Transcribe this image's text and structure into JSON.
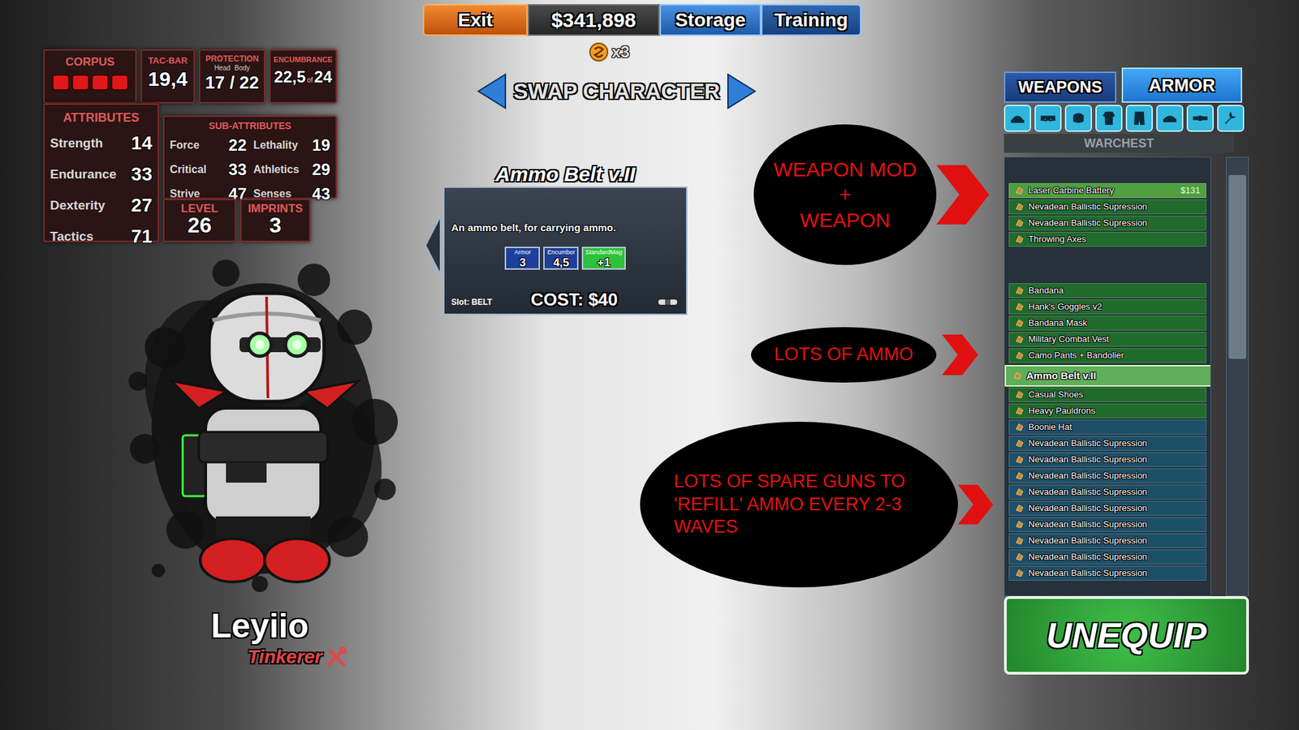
{
  "top_bar": {
    "exit": "Exit",
    "money": "$341,898",
    "storage": "Storage",
    "training": "Training"
  },
  "tokens": {
    "count": "x3"
  },
  "swap_character": {
    "label": "SWAP CHARACTER"
  },
  "stats": {
    "corpus": {
      "label": "CORPUS",
      "pips": [
        {
          "filled": true
        },
        {
          "filled": true
        },
        {
          "filled": true
        },
        {
          "filled": true
        }
      ]
    },
    "tac_bar": {
      "label": "TAC-BAR",
      "value": "19,4"
    },
    "protection": {
      "label": "PROTECTION",
      "head_label": "Head",
      "body_label": "Body",
      "value": "17 / 22"
    },
    "encumbrance": {
      "label": "ENCUMBRANCE",
      "value": "22,5",
      "of": "of",
      "max": "24"
    },
    "attributes": {
      "label": "ATTRIBUTES",
      "items": [
        {
          "name": "Strength",
          "value": "14"
        },
        {
          "name": "Endurance",
          "value": "33"
        },
        {
          "name": "Dexterity",
          "value": "27"
        },
        {
          "name": "Tactics",
          "value": "71"
        }
      ]
    },
    "sub_attributes": {
      "label": "SUB-ATTRIBUTES",
      "items": [
        {
          "name": "Force",
          "value": "22"
        },
        {
          "name": "Lethality",
          "value": "19"
        },
        {
          "name": "Critical",
          "value": "33"
        },
        {
          "name": "Athletics",
          "value": "29"
        },
        {
          "name": "Strive",
          "value": "47"
        },
        {
          "name": "Senses",
          "value": "43"
        }
      ]
    },
    "level": {
      "label": "LEVEL",
      "value": "26"
    },
    "imprints": {
      "label": "IMPRINTS",
      "value": "3"
    }
  },
  "character": {
    "name": "Leyiio",
    "class": "Tinkerer"
  },
  "tooltip": {
    "title": "Ammo Belt v.II",
    "description": "An ammo belt, for carrying ammo.",
    "stats": [
      {
        "label": "Armor",
        "value": "3",
        "color": "#1e3f9a"
      },
      {
        "label": "Encumber",
        "value": "4,5",
        "color": "#1e3f9a"
      },
      {
        "label": "StandardMag",
        "value": "+1",
        "color": "#2cc23a"
      }
    ],
    "slot": "Slot: BELT",
    "cost": "COST: $40"
  },
  "inventory": {
    "tabs": [
      {
        "label": "WEAPONS",
        "selected": false
      },
      {
        "label": "ARMOR",
        "selected": true
      }
    ],
    "slots": [
      {
        "selected": false
      },
      {
        "selected": false
      },
      {
        "selected": false
      },
      {
        "selected": false
      },
      {
        "selected": false
      },
      {
        "selected": false
      },
      {
        "selected": false
      },
      {
        "selected": false
      }
    ],
    "header": "WARCHEST",
    "sections": [
      {
        "items": [
          {
            "name": "Laser Carbine Battery",
            "price": "$131",
            "color": "#4f9e3f",
            "selected": false
          },
          {
            "name": "Nevadean Ballistic Supression",
            "price": "",
            "color": "#1f6b2b",
            "selected": false
          },
          {
            "name": "Nevadean Ballistic Supression",
            "price": "",
            "color": "#1f6b2b",
            "selected": false
          },
          {
            "name": "Throwing Axes",
            "price": "",
            "color": "#1f6b2b",
            "selected": false
          }
        ]
      },
      {
        "items": [
          {
            "name": "Bandana",
            "price": "",
            "color": "#1f6b2b",
            "selected": false
          },
          {
            "name": "Hank's Goggles v2",
            "price": "",
            "color": "#1f6b2b",
            "selected": false
          },
          {
            "name": "Bandana Mask",
            "price": "",
            "color": "#1f6b2b",
            "selected": false
          },
          {
            "name": "Military Combat Vest",
            "price": "",
            "color": "#1f6b2b",
            "selected": false
          },
          {
            "name": "Camo Pants + Bandolier",
            "price": "",
            "color": "#1f6b2b",
            "selected": false
          },
          {
            "name": "Ammo Belt v.II",
            "price": "",
            "color": "#5fae58",
            "selected": true
          },
          {
            "name": "Casual Shoes",
            "price": "",
            "color": "#1f6b2b",
            "selected": false
          },
          {
            "name": "Heavy Pauldrons",
            "price": "",
            "color": "#1f6b2b",
            "selected": false
          },
          {
            "name": "Boonie Hat",
            "price": "",
            "color": "#1d4f69",
            "selected": false
          },
          {
            "name": "Nevadean Ballistic Supression",
            "price": "",
            "color": "#1d4f69",
            "selected": false
          },
          {
            "name": "Nevadean Ballistic Supression",
            "price": "",
            "color": "#1d4f69",
            "selected": false
          },
          {
            "name": "Nevadean Ballistic Supression",
            "price": "",
            "color": "#1d4f69",
            "selected": false
          },
          {
            "name": "Nevadean Ballistic Supression",
            "price": "",
            "color": "#1d4f69",
            "selected": false
          },
          {
            "name": "Nevadean Ballistic Supression",
            "price": "",
            "color": "#1d4f69",
            "selected": false
          },
          {
            "name": "Nevadean Ballistic Supression",
            "price": "",
            "color": "#1d4f69",
            "selected": false
          },
          {
            "name": "Nevadean Ballistic Supression",
            "price": "",
            "color": "#1d4f69",
            "selected": false
          },
          {
            "name": "Nevadean Ballistic Supression",
            "price": "",
            "color": "#1d4f69",
            "selected": false
          },
          {
            "name": "Nevadean Ballistic Supression",
            "price": "",
            "color": "#1d4f69",
            "selected": false
          }
        ]
      }
    ],
    "scrollbar": {
      "thumb_start": 0.04,
      "thumb_size": 0.42
    },
    "action": "UNEQUIP"
  },
  "annotations": [
    {
      "lines": [
        "WEAPON MOD",
        "+",
        "WEAPON"
      ]
    },
    {
      "lines": [
        "LOTS OF AMMO"
      ]
    },
    {
      "lines": [
        "LOTS OF SPARE GUNS TO",
        "'REFILL' AMMO EVERY 2-3",
        "WAVES"
      ]
    }
  ]
}
